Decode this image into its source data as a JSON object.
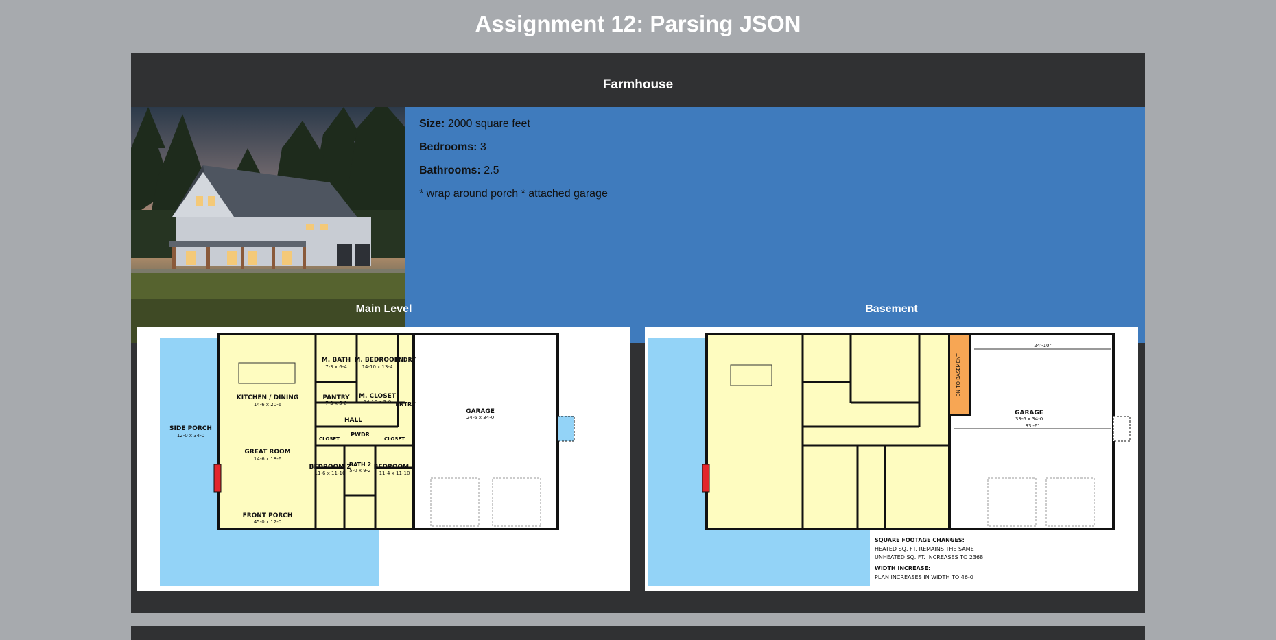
{
  "page": {
    "title": "Assignment 12: Parsing JSON"
  },
  "house": {
    "name": "Farmhouse",
    "photo_icon": "farmhouse-photo",
    "size_label": "Size:",
    "size_value": "2000 square feet",
    "bedrooms_label": "Bedrooms:",
    "bedrooms_value": "3",
    "bathrooms_label": "Bathrooms:",
    "bathrooms_value": "2.5",
    "features": "* wrap around porch * attached garage"
  },
  "plans": {
    "main": {
      "title": "Main Level",
      "labels": {
        "side_porch": "SIDE PORCH",
        "side_porch_dim": "12-0 x 34-0",
        "kitchen": "KITCHEN / DINING",
        "kitchen_dim": "14-6 x 20-6",
        "m_bath": "M. BATH",
        "m_bath_dim": "7-3 x 6-4",
        "m_bedroom": "M. BEDROOM",
        "m_bedroom_dim": "14-10 x 13-4",
        "lndry": "LNDRY",
        "pantry": "PANTRY",
        "pantry_dim": "7-3 x 5-0",
        "m_closet": "M. CLOSET",
        "m_closet_dim": "14-10 x 5-0",
        "entry": "ENTRY",
        "hall": "HALL",
        "garage": "GARAGE",
        "garage_dim": "24-6 x 34-0",
        "closet": "CLOSET",
        "pwdr": "PWDR",
        "great_room": "GREAT ROOM",
        "great_room_dim": "14-6 x 18-6",
        "bedroom2": "BEDROOM 2",
        "bedroom2_dim": "11-6 x 11-10",
        "bath2": "BATH 2",
        "bath2_dim": "5-0 x 9-2",
        "bedroom3": "BEDROOM 3",
        "bedroom3_dim": "11-4 x 11-10",
        "front_porch": "FRONT PORCH",
        "front_porch_dim": "45-0 x 12-0"
      }
    },
    "basement": {
      "title": "Basement",
      "labels": {
        "garage": "GARAGE",
        "garage_dim": "33-6 x 34-0",
        "stairs": "DN TO BASEMENT",
        "dim_top": "24'-10\"",
        "dim_mid": "33'-6\"",
        "sqft_title": "SQUARE FOOTAGE CHANGES:",
        "sqft_line1": "HEATED SQ. FT. REMAINS THE SAME",
        "sqft_line2": "UNHEATED SQ. FT. INCREASES TO 2368",
        "width_title": "WIDTH INCREASE:",
        "width_line1": "PLAN INCREASES IN WIDTH TO 46-0"
      }
    }
  },
  "colors": {
    "background": "#a7aaae",
    "card": "#303133",
    "details": "#3f7bbd",
    "porch": "#93d3f7",
    "interior": "#fefcc0",
    "fireplace": "#e3262b",
    "stairs": "#f7a654"
  }
}
